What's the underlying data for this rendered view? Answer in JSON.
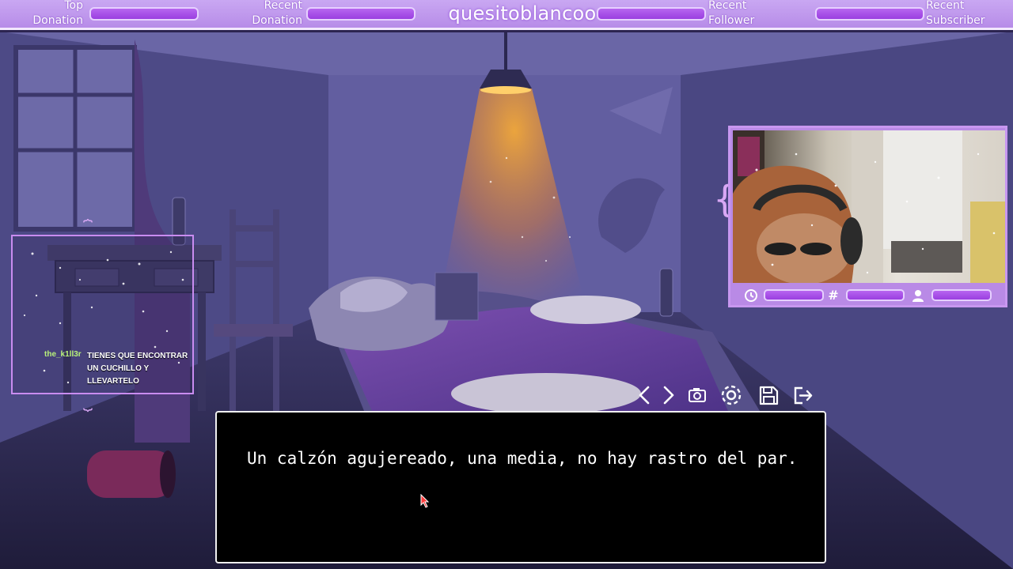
{
  "stream": {
    "channel": "quesitoblancoo",
    "widgets": [
      {
        "label_line1": "Top",
        "label_line2": "Donation"
      },
      {
        "label_line1": "Recent",
        "label_line2": "Donation"
      },
      {
        "label_line1": "Recent",
        "label_line2": "Follower"
      },
      {
        "label_line1": "Recent",
        "label_line2": "Subscriber"
      }
    ]
  },
  "chat": {
    "username": "the_k1ll3r",
    "message": "TIENES QUE ENCONTRAR UN CUCHILLO Y LLEVARTELO"
  },
  "webcam": {
    "status_icons": [
      "clock-icon",
      "hash-icon",
      "user-icon"
    ]
  },
  "game": {
    "toolbar": [
      "back-icon",
      "forward-icon",
      "camera-icon",
      "settings-icon",
      "save-icon",
      "exit-icon"
    ],
    "dialogue": "Un calzón agujereado, una media, no hay rastro del par."
  },
  "colors": {
    "accent": "#b765f0",
    "frame": "#c897f0",
    "chat_user": "#b9f27a",
    "lamp": "#f0a030"
  }
}
